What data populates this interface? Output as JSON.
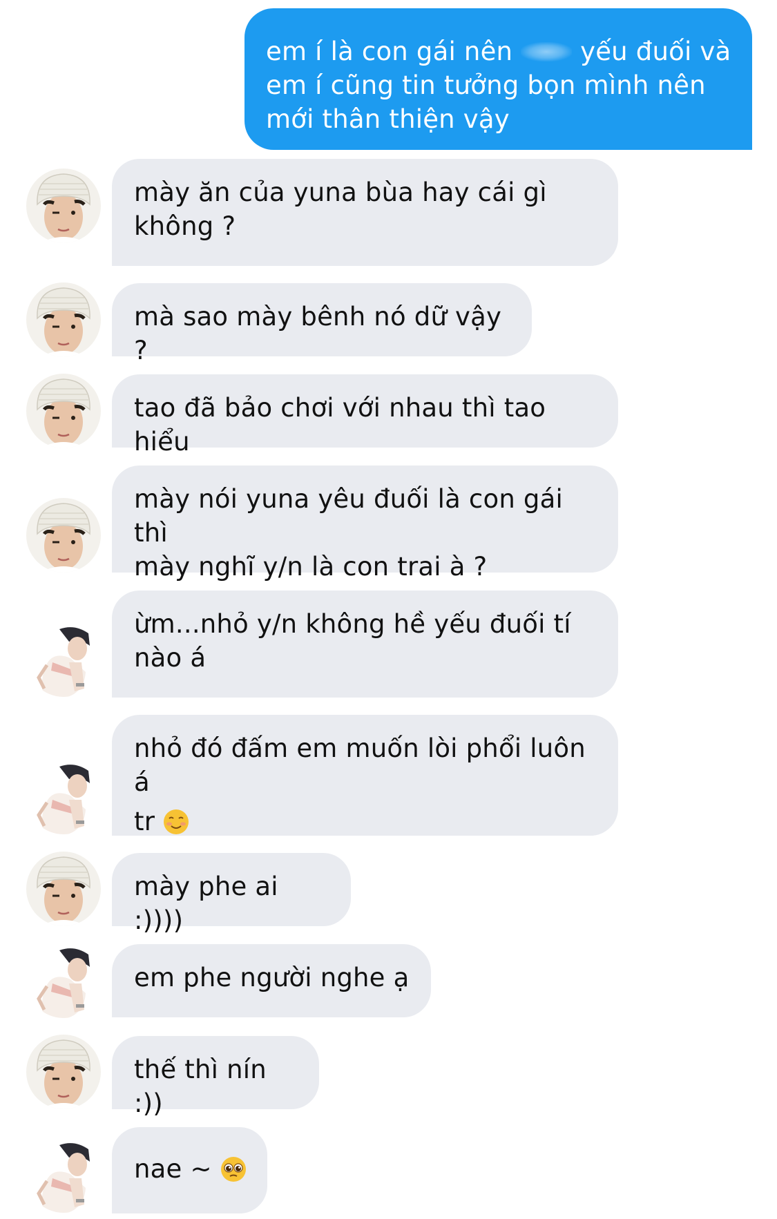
{
  "conversation": {
    "outgoing": {
      "line1_before": "em í là con gái nên",
      "line1_after": "yếu đuối và",
      "line2": "em í cũng tin tưởng bọn mình nên",
      "line3": "mới thân thiện vậy"
    },
    "messages": [
      {
        "sender": "beanie",
        "lines": [
          "mày ăn của yuna bùa hay cái gì",
          "không ?"
        ]
      },
      {
        "sender": "beanie",
        "lines": [
          "mà sao mày bênh nó dữ vậy ?"
        ]
      },
      {
        "sender": "beanie",
        "lines": [
          "tao đã bảo chơi với nhau thì tao hiểu"
        ]
      },
      {
        "sender": "beanie",
        "lines": [
          "mày nói yuna yêu đuối là con gái thì",
          "mày nghĩ y/n là con trai à ?"
        ]
      },
      {
        "sender": "posing",
        "lines": [
          "ừm...nhỏ y/n không hề yếu đuối tí",
          "nào á"
        ]
      },
      {
        "sender": "posing",
        "lines": [
          "nhỏ đó đấm em muốn lòi phổi luôn á",
          "tr"
        ],
        "emoji": "smiling-face-emoji"
      },
      {
        "sender": "beanie",
        "lines": [
          "mày phe ai :))))"
        ]
      },
      {
        "sender": "posing",
        "lines": [
          "em phe người nghe ạ"
        ]
      },
      {
        "sender": "beanie",
        "lines": [
          "thế thì nín :))"
        ]
      },
      {
        "sender": "posing",
        "lines": [
          "nae ~"
        ],
        "emoji": "pleading-face-emoji"
      }
    ]
  },
  "colors": {
    "outgoing_bubble": "#1d9bf0",
    "incoming_bubble": "#e9ebf0",
    "background": "#ffffff",
    "text_dark": "#111111",
    "text_light": "#ffffff"
  }
}
